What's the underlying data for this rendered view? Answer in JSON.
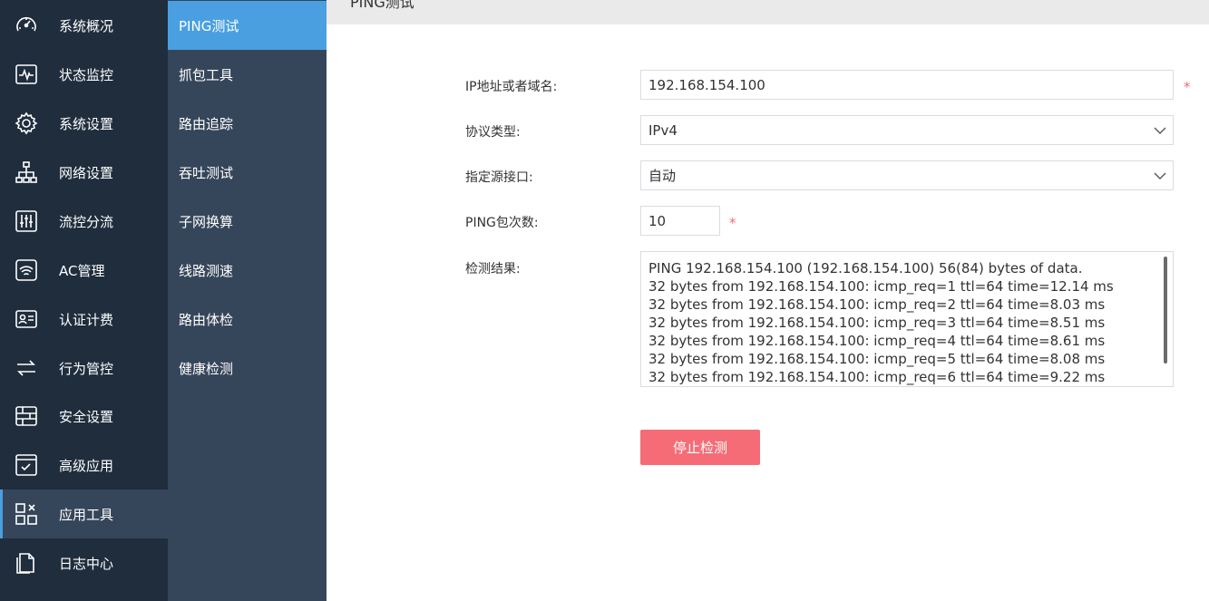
{
  "nav": {
    "items": [
      {
        "label": "系统概况",
        "icon": "dashboard-icon"
      },
      {
        "label": "状态监控",
        "icon": "pulse-monitor-icon"
      },
      {
        "label": "系统设置",
        "icon": "gear-icon"
      },
      {
        "label": "网络设置",
        "icon": "network-icon"
      },
      {
        "label": "流控分流",
        "icon": "sliders-icon"
      },
      {
        "label": "AC管理",
        "icon": "wifi-icon"
      },
      {
        "label": "认证计费",
        "icon": "id-card-icon"
      },
      {
        "label": "行为管控",
        "icon": "swap-arrows-icon"
      },
      {
        "label": "安全设置",
        "icon": "firewall-icon"
      },
      {
        "label": "高级应用",
        "icon": "checklist-icon"
      },
      {
        "label": "应用工具",
        "icon": "tools-icon"
      },
      {
        "label": "日志中心",
        "icon": "log-file-icon"
      }
    ],
    "active_index": 10
  },
  "subnav": {
    "items": [
      {
        "label": "PING测试"
      },
      {
        "label": "抓包工具"
      },
      {
        "label": "路由追踪"
      },
      {
        "label": "吞吐测试"
      },
      {
        "label": "子网换算"
      },
      {
        "label": "线路测速"
      },
      {
        "label": "路由体检"
      },
      {
        "label": "健康检测"
      }
    ],
    "active_index": 0
  },
  "page": {
    "title": "PING测试"
  },
  "form": {
    "host": {
      "label": "IP地址或者域名:",
      "value": "192.168.154.100",
      "required_mark": "*"
    },
    "protocol": {
      "label": "协议类型:",
      "value": "IPv4"
    },
    "interface": {
      "label": "指定源接口:",
      "value": "自动"
    },
    "count": {
      "label": "PING包次数:",
      "value": "10",
      "required_mark": "*"
    },
    "result": {
      "label": "检测结果:",
      "lines": [
        "PING 192.168.154.100 (192.168.154.100) 56(84) bytes of data.",
        "32 bytes from 192.168.154.100: icmp_req=1 ttl=64 time=12.14 ms",
        "32 bytes from 192.168.154.100: icmp_req=2 ttl=64 time=8.03 ms",
        "32 bytes from 192.168.154.100: icmp_req=3 ttl=64 time=8.51 ms",
        "32 bytes from 192.168.154.100: icmp_req=4 ttl=64 time=8.61 ms",
        "32 bytes from 192.168.154.100: icmp_req=5 ttl=64 time=8.08 ms",
        "32 bytes from 192.168.154.100: icmp_req=6 ttl=64 time=9.22 ms"
      ]
    },
    "stop_label": "停止检测"
  },
  "colors": {
    "nav_bg": "#1f2d3d",
    "subnav_bg": "#36465a",
    "accent": "#4a9fe0",
    "danger": "#f56c76"
  }
}
